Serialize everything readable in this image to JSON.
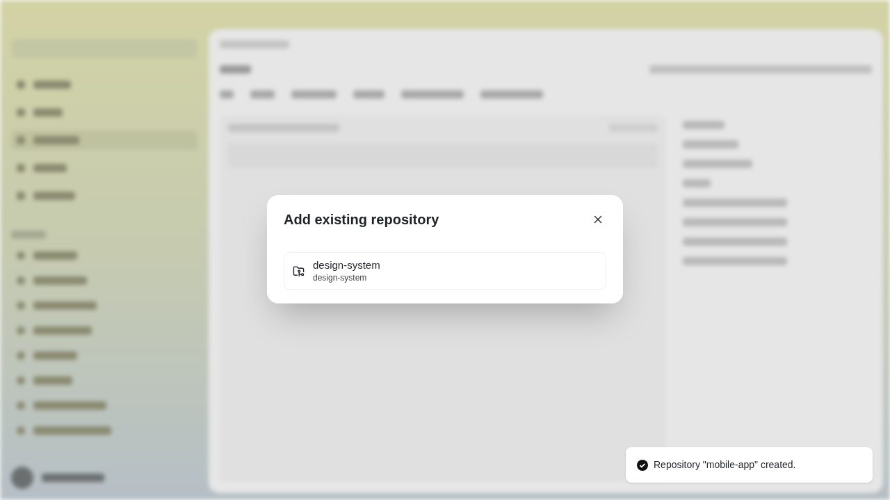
{
  "dialog": {
    "title": "Add existing repository",
    "repositories": [
      {
        "name": "design-system",
        "path": "design-system"
      }
    ]
  },
  "toast": {
    "message": "Repository \"mobile-app\" created."
  }
}
